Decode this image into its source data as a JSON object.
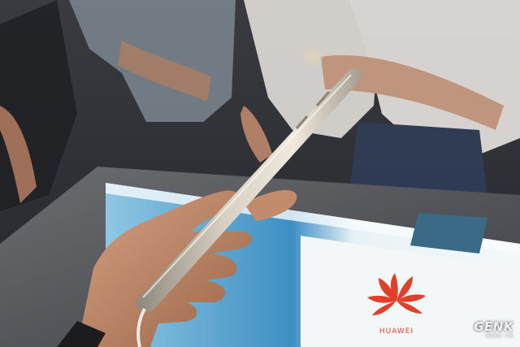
{
  "scene": {
    "description_alt": "Hand holding a smartphone edge-on above an illuminated display stand",
    "colors": {
      "background": "#2a2b30",
      "counter": "#55575c",
      "display_glow": "#cfe6ef",
      "display_blue": "#3d8fc4",
      "logo_red": "#e0402a",
      "phone_body": "#c9c1b4",
      "skin": "#c08a6a"
    }
  },
  "display_sign": {
    "brand_text": "HUAWEI"
  },
  "watermark": {
    "main": "GENK",
    "sub": "GENK.VN"
  }
}
